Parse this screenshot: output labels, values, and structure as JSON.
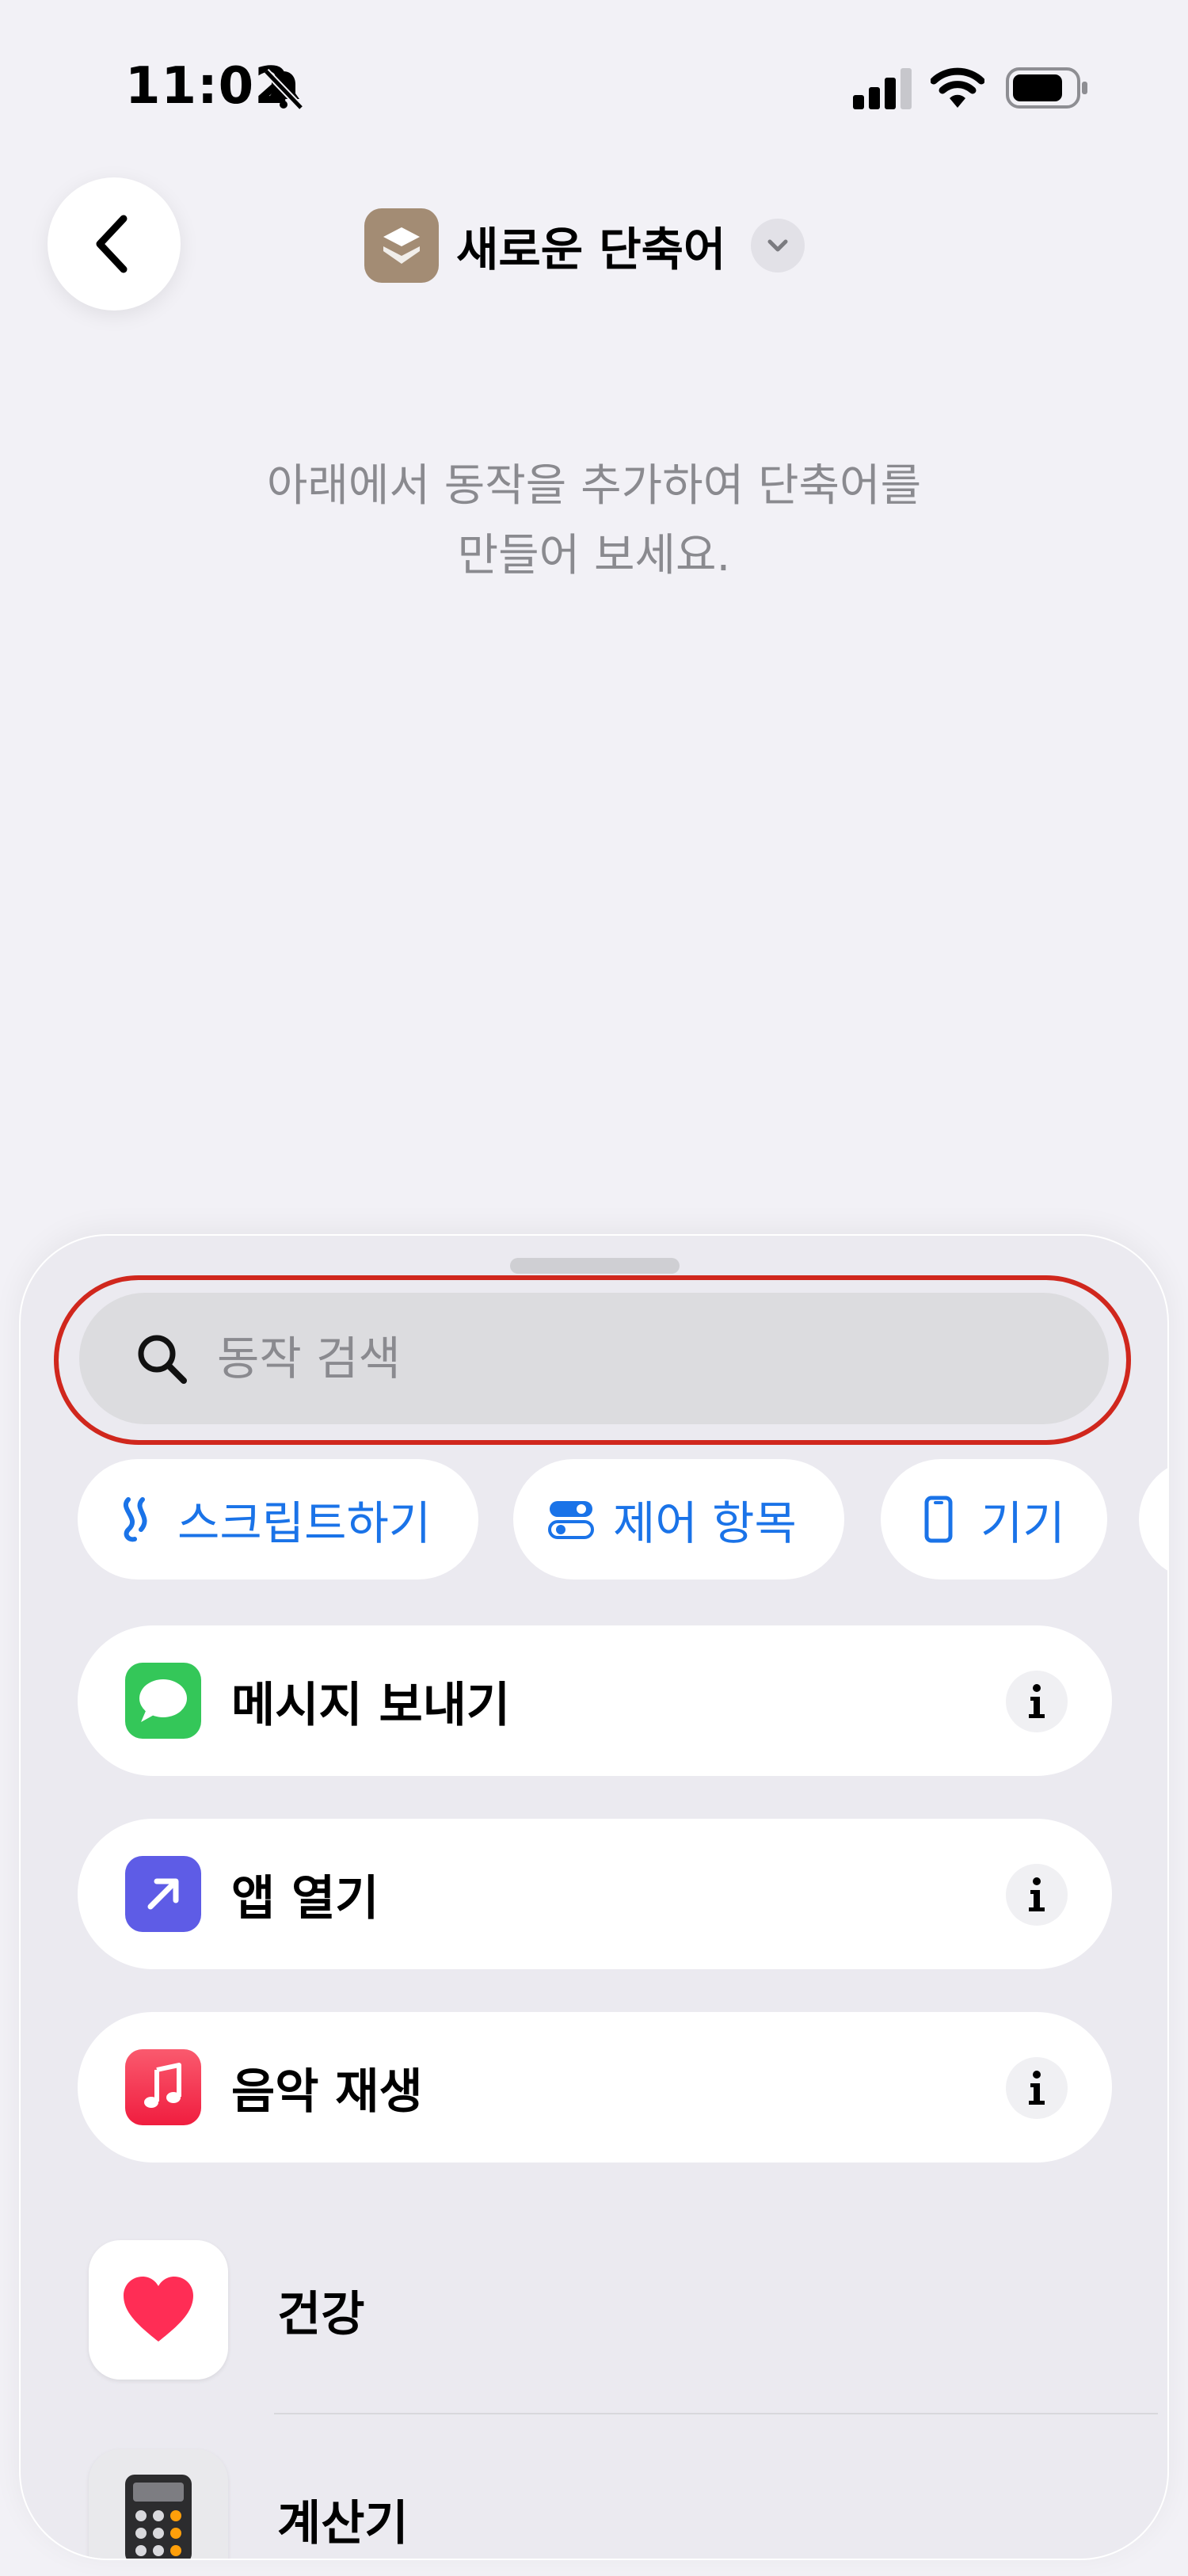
{
  "status_bar": {
    "time": "11:02"
  },
  "header": {
    "title": "새로운 단축어"
  },
  "hint": {
    "line1": "아래에서 동작을 추가하여 단축어를",
    "line2": "만들어 보세요."
  },
  "search": {
    "placeholder": "동작 검색"
  },
  "chips": [
    {
      "label": "스크립트하기",
      "icon": "script-icon"
    },
    {
      "label": "제어 항목",
      "icon": "toggles-icon"
    },
    {
      "label": "기기",
      "icon": "phone-icon"
    }
  ],
  "actions": [
    {
      "label": "메시지 보내기",
      "icon": "messages-icon",
      "color": "#34c759"
    },
    {
      "label": "앱 열기",
      "icon": "arrow-up-right-icon",
      "color": "#5e5ce6"
    },
    {
      "label": "음악 재생",
      "icon": "music-note-icon",
      "color": "#fa2d48"
    }
  ],
  "apps": [
    {
      "label": "건강",
      "icon": "heart-icon"
    },
    {
      "label": "계산기",
      "icon": "calculator-icon"
    }
  ],
  "colors": {
    "accent": "#1a73e8",
    "highlight": "#d0271d",
    "sheet": "#ebeaf0"
  }
}
